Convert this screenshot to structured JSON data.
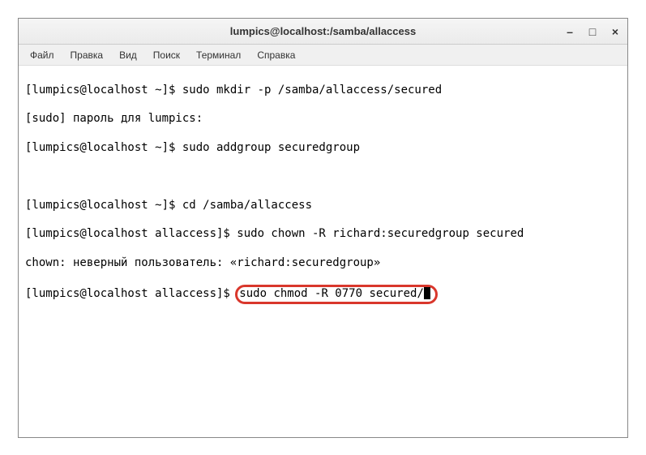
{
  "titlebar": {
    "title": "lumpics@localhost:/samba/allaccess"
  },
  "menu": {
    "file": "Файл",
    "edit": "Правка",
    "view": "Вид",
    "search": "Поиск",
    "terminal": "Терминал",
    "help": "Справка"
  },
  "terminal": {
    "line1": "[lumpics@localhost ~]$ sudo mkdir -p /samba/allaccess/secured",
    "line2": "[sudo] пароль для lumpics:",
    "line3": "[lumpics@localhost ~]$ sudo addgroup securedgroup",
    "line4": "",
    "line5": "[lumpics@localhost ~]$ cd /samba/allaccess",
    "line6": "[lumpics@localhost allaccess]$ sudo chown -R richard:securedgroup secured",
    "line7": "chown: неверный пользователь: «richard:securedgroup»",
    "line8_prompt": "[lumpics@localhost allaccess]$ ",
    "line8_cmd": "sudo chmod -R 0770 secured/"
  },
  "highlight": {
    "color": "#d9372c"
  }
}
